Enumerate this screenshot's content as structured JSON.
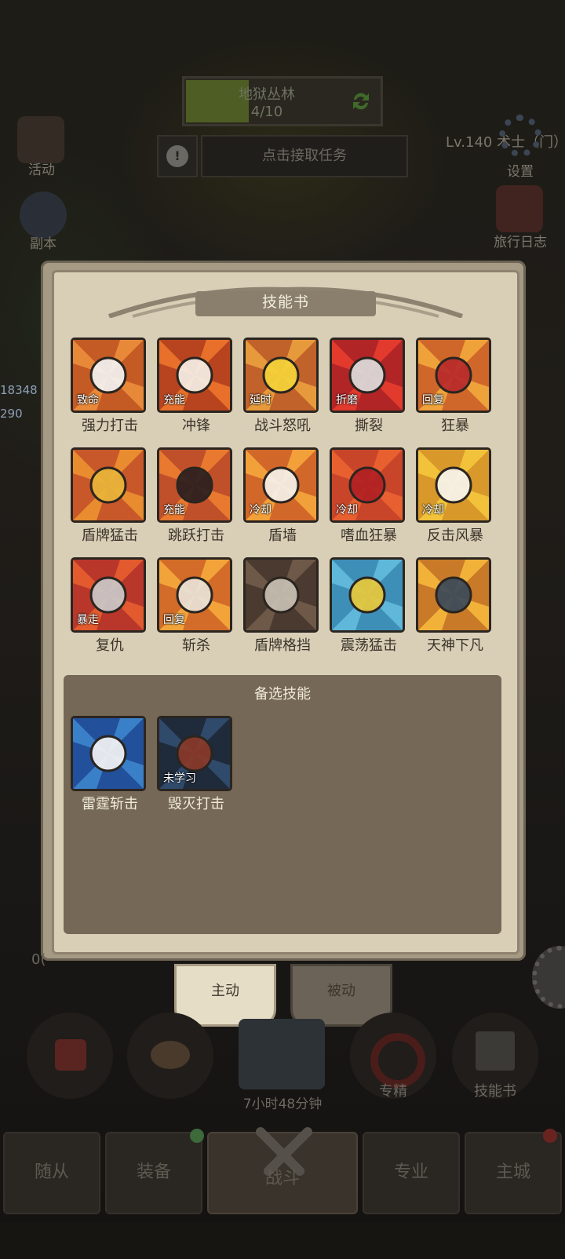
{
  "header": {
    "area_name": "地狱丛林",
    "progress_text": "4/10",
    "progress_fraction": 0.4,
    "task_text": "点击接取任务",
    "player_text": "Lv.140 术士（门）"
  },
  "left_side": {
    "activity_label": "活动",
    "dungeon_label": "副本",
    "stat_1": "18348",
    "stat_2": "290"
  },
  "right_side": {
    "settings_label": "设置",
    "journal_label": "旅行日志"
  },
  "panel": {
    "title": "技能书",
    "skills": [
      {
        "name": "强力打击",
        "tag": "致命",
        "icon": "sword-icon"
      },
      {
        "name": "冲锋",
        "tag": "充能",
        "icon": "charge-icon"
      },
      {
        "name": "战斗怒吼",
        "tag": "延时",
        "icon": "shout-icon"
      },
      {
        "name": "撕裂",
        "tag": "折磨",
        "icon": "rend-icon"
      },
      {
        "name": "狂暴",
        "tag": "回复",
        "icon": "berserk-hood-icon"
      },
      {
        "name": "盾牌猛击",
        "tag": "",
        "icon": "shield-fist-icon"
      },
      {
        "name": "跳跃打击",
        "tag": "充能",
        "icon": "leap-icon"
      },
      {
        "name": "盾墙",
        "tag": "冷却",
        "icon": "shield-wall-icon"
      },
      {
        "name": "嗜血狂暴",
        "tag": "冷却",
        "icon": "blood-mask-icon"
      },
      {
        "name": "反击风暴",
        "tag": "冷却",
        "icon": "counter-storm-icon"
      },
      {
        "name": "复仇",
        "tag": "暴走",
        "icon": "revenge-sword-icon"
      },
      {
        "name": "斩杀",
        "tag": "回复",
        "icon": "execute-icon"
      },
      {
        "name": "盾牌格挡",
        "tag": "",
        "icon": "shield-block-icon"
      },
      {
        "name": "震荡猛击",
        "tag": "",
        "icon": "concussive-blow-icon"
      },
      {
        "name": "天神下凡",
        "tag": "",
        "icon": "avatar-icon"
      }
    ],
    "reserve_title": "备选技能",
    "reserve_skills": [
      {
        "name": "雷霆斩击",
        "tag": "",
        "icon": "thunder-slash-icon"
      },
      {
        "name": "毁灭打击",
        "tag": "未学习",
        "icon": "devastate-icon"
      }
    ]
  },
  "tabs": {
    "active_label": "主动",
    "passive_label": "被动"
  },
  "dock": {
    "timer_text": "7小时48分钟",
    "specialty_label": "专精",
    "skillbook_label": "技能书",
    "stray_text": "0("
  },
  "nav": {
    "followers": "随从",
    "equipment": "装备",
    "battle": "战斗",
    "profession": "专业",
    "main_city": "主城"
  },
  "colors": {
    "progress_green": "#4e5d23",
    "panel_parchment": "#d9cfb7",
    "reserve_bg": "#756856"
  }
}
